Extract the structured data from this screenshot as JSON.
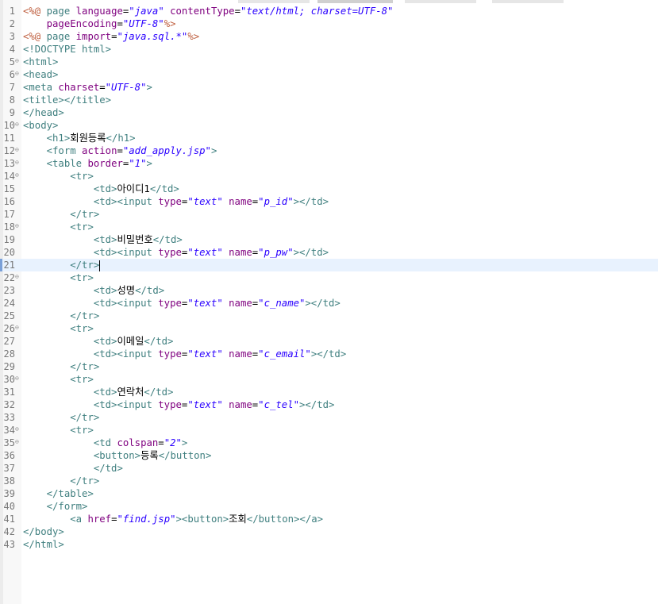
{
  "editor": {
    "current_line": 21,
    "lines": [
      {
        "n": "1",
        "fold": false,
        "tokens": [
          [
            "d",
            "<%@ "
          ],
          [
            "k",
            "page "
          ],
          [
            "a",
            "language"
          ],
          [
            "x",
            "="
          ],
          [
            "v",
            "\"java\""
          ],
          [
            "x",
            " "
          ],
          [
            "a",
            "contentType"
          ],
          [
            "x",
            "="
          ],
          [
            "v",
            "\"text/html; charset=UTF-8\""
          ]
        ]
      },
      {
        "n": "2",
        "fold": false,
        "tokens": [
          [
            "x",
            "    "
          ],
          [
            "a",
            "pageEncoding"
          ],
          [
            "x",
            "="
          ],
          [
            "v",
            "\"UTF-8\""
          ],
          [
            "d",
            "%>"
          ]
        ]
      },
      {
        "n": "3",
        "fold": false,
        "tokens": [
          [
            "d",
            "<%@ "
          ],
          [
            "k",
            "page "
          ],
          [
            "a",
            "import"
          ],
          [
            "x",
            "="
          ],
          [
            "v",
            "\"java.sql.*\""
          ],
          [
            "d",
            "%>"
          ]
        ]
      },
      {
        "n": "4",
        "fold": false,
        "tokens": [
          [
            "t",
            "<!DOCTYPE html>"
          ]
        ]
      },
      {
        "n": "5",
        "fold": true,
        "tokens": [
          [
            "t",
            "<html>"
          ]
        ]
      },
      {
        "n": "6",
        "fold": true,
        "tokens": [
          [
            "t",
            "<head>"
          ]
        ]
      },
      {
        "n": "7",
        "fold": false,
        "tokens": [
          [
            "t",
            "<meta "
          ],
          [
            "a",
            "charset"
          ],
          [
            "x",
            "="
          ],
          [
            "v",
            "\"UTF-8\""
          ],
          [
            "t",
            ">"
          ]
        ]
      },
      {
        "n": "8",
        "fold": false,
        "tokens": [
          [
            "t",
            "<title></title>"
          ]
        ]
      },
      {
        "n": "9",
        "fold": false,
        "tokens": [
          [
            "t",
            "</head>"
          ]
        ]
      },
      {
        "n": "10",
        "fold": true,
        "tokens": [
          [
            "t",
            "<body>"
          ]
        ]
      },
      {
        "n": "11",
        "fold": false,
        "tokens": [
          [
            "x",
            "    "
          ],
          [
            "t",
            "<h1>"
          ],
          [
            "x",
            "회원등록"
          ],
          [
            "t",
            "</h1>"
          ]
        ]
      },
      {
        "n": "12",
        "fold": true,
        "tokens": [
          [
            "x",
            "    "
          ],
          [
            "t",
            "<form "
          ],
          [
            "a",
            "action"
          ],
          [
            "x",
            "="
          ],
          [
            "v",
            "\"add_apply.jsp\""
          ],
          [
            "t",
            ">"
          ]
        ]
      },
      {
        "n": "13",
        "fold": true,
        "tokens": [
          [
            "x",
            "    "
          ],
          [
            "t",
            "<table "
          ],
          [
            "a",
            "border"
          ],
          [
            "x",
            "="
          ],
          [
            "v",
            "\"1\""
          ],
          [
            "t",
            ">"
          ]
        ]
      },
      {
        "n": "14",
        "fold": true,
        "tokens": [
          [
            "x",
            "        "
          ],
          [
            "t",
            "<tr>"
          ]
        ]
      },
      {
        "n": "15",
        "fold": false,
        "tokens": [
          [
            "x",
            "            "
          ],
          [
            "t",
            "<td>"
          ],
          [
            "x",
            "아이디1"
          ],
          [
            "t",
            "</td>"
          ]
        ]
      },
      {
        "n": "16",
        "fold": false,
        "tokens": [
          [
            "x",
            "            "
          ],
          [
            "t",
            "<td><input "
          ],
          [
            "a",
            "type"
          ],
          [
            "x",
            "="
          ],
          [
            "v",
            "\"text\""
          ],
          [
            "x",
            " "
          ],
          [
            "a",
            "name"
          ],
          [
            "x",
            "="
          ],
          [
            "v",
            "\"p_id\""
          ],
          [
            "t",
            "></td>"
          ]
        ]
      },
      {
        "n": "17",
        "fold": false,
        "tokens": [
          [
            "x",
            "        "
          ],
          [
            "t",
            "</tr>"
          ]
        ]
      },
      {
        "n": "18",
        "fold": true,
        "tokens": [
          [
            "x",
            "        "
          ],
          [
            "t",
            "<tr>"
          ]
        ]
      },
      {
        "n": "19",
        "fold": false,
        "tokens": [
          [
            "x",
            "            "
          ],
          [
            "t",
            "<td>"
          ],
          [
            "x",
            "비밀번호"
          ],
          [
            "t",
            "</td>"
          ]
        ]
      },
      {
        "n": "20",
        "fold": false,
        "tokens": [
          [
            "x",
            "            "
          ],
          [
            "t",
            "<td><input "
          ],
          [
            "a",
            "type"
          ],
          [
            "x",
            "="
          ],
          [
            "v",
            "\"text\""
          ],
          [
            "x",
            " "
          ],
          [
            "a",
            "name"
          ],
          [
            "x",
            "="
          ],
          [
            "v",
            "\"p_pw\""
          ],
          [
            "t",
            "></td>"
          ]
        ]
      },
      {
        "n": "21",
        "fold": false,
        "tokens": [
          [
            "x",
            "        "
          ],
          [
            "t",
            "</tr>"
          ]
        ]
      },
      {
        "n": "22",
        "fold": true,
        "tokens": [
          [
            "x",
            "        "
          ],
          [
            "t",
            "<tr>"
          ]
        ]
      },
      {
        "n": "23",
        "fold": false,
        "tokens": [
          [
            "x",
            "            "
          ],
          [
            "t",
            "<td>"
          ],
          [
            "x",
            "성명"
          ],
          [
            "t",
            "</td>"
          ]
        ]
      },
      {
        "n": "24",
        "fold": false,
        "tokens": [
          [
            "x",
            "            "
          ],
          [
            "t",
            "<td><input "
          ],
          [
            "a",
            "type"
          ],
          [
            "x",
            "="
          ],
          [
            "v",
            "\"text\""
          ],
          [
            "x",
            " "
          ],
          [
            "a",
            "name"
          ],
          [
            "x",
            "="
          ],
          [
            "v",
            "\"c_name\""
          ],
          [
            "t",
            "></td>"
          ]
        ]
      },
      {
        "n": "25",
        "fold": false,
        "tokens": [
          [
            "x",
            "        "
          ],
          [
            "t",
            "</tr>"
          ]
        ]
      },
      {
        "n": "26",
        "fold": true,
        "tokens": [
          [
            "x",
            "        "
          ],
          [
            "t",
            "<tr>"
          ]
        ]
      },
      {
        "n": "27",
        "fold": false,
        "tokens": [
          [
            "x",
            "            "
          ],
          [
            "t",
            "<td>"
          ],
          [
            "x",
            "이메일"
          ],
          [
            "t",
            "</td>"
          ]
        ]
      },
      {
        "n": "28",
        "fold": false,
        "tokens": [
          [
            "x",
            "            "
          ],
          [
            "t",
            "<td><input "
          ],
          [
            "a",
            "type"
          ],
          [
            "x",
            "="
          ],
          [
            "v",
            "\"text\""
          ],
          [
            "x",
            " "
          ],
          [
            "a",
            "name"
          ],
          [
            "x",
            "="
          ],
          [
            "v",
            "\"c_email\""
          ],
          [
            "t",
            "></td>"
          ]
        ]
      },
      {
        "n": "29",
        "fold": false,
        "tokens": [
          [
            "x",
            "        "
          ],
          [
            "t",
            "</tr>"
          ]
        ]
      },
      {
        "n": "30",
        "fold": true,
        "tokens": [
          [
            "x",
            "        "
          ],
          [
            "t",
            "<tr>"
          ]
        ]
      },
      {
        "n": "31",
        "fold": false,
        "tokens": [
          [
            "x",
            "            "
          ],
          [
            "t",
            "<td>"
          ],
          [
            "x",
            "연락처"
          ],
          [
            "t",
            "</td>"
          ]
        ]
      },
      {
        "n": "32",
        "fold": false,
        "tokens": [
          [
            "x",
            "            "
          ],
          [
            "t",
            "<td><input "
          ],
          [
            "a",
            "type"
          ],
          [
            "x",
            "="
          ],
          [
            "v",
            "\"text\""
          ],
          [
            "x",
            " "
          ],
          [
            "a",
            "name"
          ],
          [
            "x",
            "="
          ],
          [
            "v",
            "\"c_tel\""
          ],
          [
            "t",
            "></td>"
          ]
        ]
      },
      {
        "n": "33",
        "fold": false,
        "tokens": [
          [
            "x",
            "        "
          ],
          [
            "t",
            "</tr>"
          ]
        ]
      },
      {
        "n": "34",
        "fold": true,
        "tokens": [
          [
            "x",
            "        "
          ],
          [
            "t",
            "<tr>"
          ]
        ]
      },
      {
        "n": "35",
        "fold": true,
        "tokens": [
          [
            "x",
            "            "
          ],
          [
            "t",
            "<td "
          ],
          [
            "a",
            "colspan"
          ],
          [
            "x",
            "="
          ],
          [
            "v",
            "\"2\""
          ],
          [
            "t",
            ">"
          ]
        ]
      },
      {
        "n": "36",
        "fold": false,
        "tokens": [
          [
            "x",
            "            "
          ],
          [
            "t",
            "<button>"
          ],
          [
            "x",
            "등록"
          ],
          [
            "t",
            "</button>"
          ]
        ]
      },
      {
        "n": "37",
        "fold": false,
        "tokens": [
          [
            "x",
            "            "
          ],
          [
            "t",
            "</td>"
          ]
        ]
      },
      {
        "n": "38",
        "fold": false,
        "tokens": [
          [
            "x",
            "        "
          ],
          [
            "t",
            "</tr>"
          ]
        ]
      },
      {
        "n": "39",
        "fold": false,
        "tokens": [
          [
            "x",
            "    "
          ],
          [
            "t",
            "</table>"
          ]
        ]
      },
      {
        "n": "40",
        "fold": false,
        "tokens": [
          [
            "x",
            "    "
          ],
          [
            "t",
            "</form>"
          ]
        ]
      },
      {
        "n": "41",
        "fold": false,
        "tokens": [
          [
            "x",
            "        "
          ],
          [
            "t",
            "<a "
          ],
          [
            "a",
            "href"
          ],
          [
            "x",
            "="
          ],
          [
            "v",
            "\"find.jsp\""
          ],
          [
            "t",
            "><button>"
          ],
          [
            "x",
            "조회"
          ],
          [
            "t",
            "</button></a>"
          ]
        ]
      },
      {
        "n": "42",
        "fold": false,
        "tokens": [
          [
            "t",
            "</body>"
          ]
        ]
      },
      {
        "n": "43",
        "fold": false,
        "tokens": [
          [
            "t",
            "</html>"
          ]
        ]
      }
    ]
  }
}
